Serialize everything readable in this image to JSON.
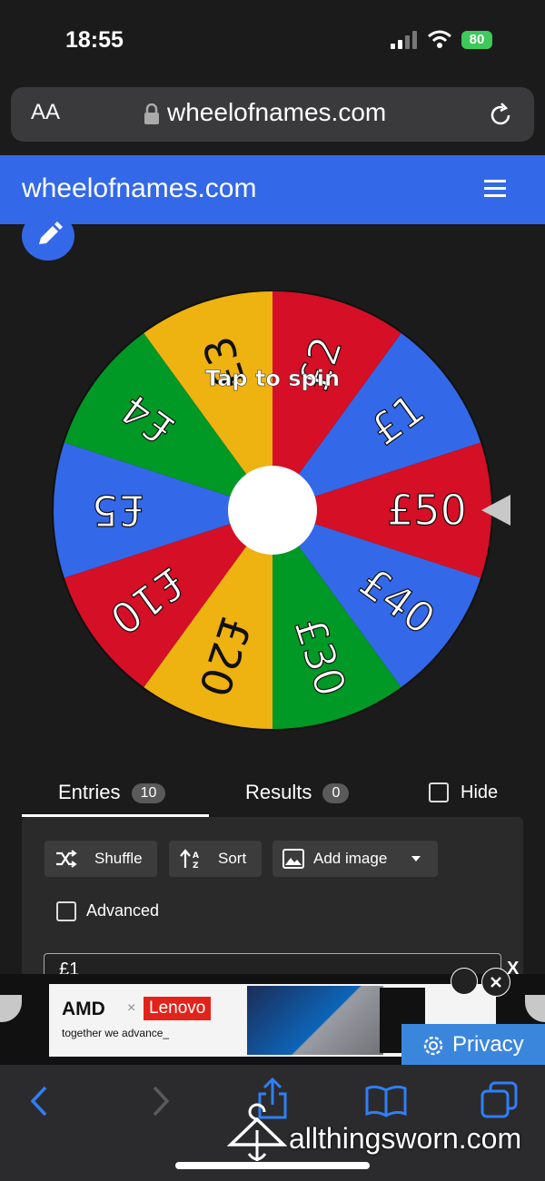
{
  "status": {
    "time": "18:55",
    "battery": "80"
  },
  "browser": {
    "text_size_label": "AA",
    "url": "wheelofnames.com"
  },
  "header": {
    "title": "wheelofnames.com"
  },
  "wheel": {
    "center_hint": "Tap to spin",
    "segments": [
      {
        "label": "£1",
        "color": "#3369e8"
      },
      {
        "label": "£50",
        "color": "#d50f25"
      },
      {
        "label": "£40",
        "color": "#3369e8"
      },
      {
        "label": "£30",
        "color": "#009925"
      },
      {
        "label": "£20",
        "color": "#eeb211"
      },
      {
        "label": "£10",
        "color": "#d50f25"
      },
      {
        "label": "£5",
        "color": "#3369e8"
      },
      {
        "label": "£4",
        "color": "#009925"
      },
      {
        "label": "£3",
        "color": "#eeb211"
      },
      {
        "label": "£2",
        "color": "#d50f25"
      }
    ]
  },
  "tabs": {
    "entries_label": "Entries",
    "entries_count": "10",
    "results_label": "Results",
    "results_count": "0",
    "hide_label": "Hide"
  },
  "toolbar": {
    "shuffle_label": "Shuffle",
    "sort_label": "Sort",
    "add_image_label": "Add image",
    "advanced_label": "Advanced"
  },
  "entries_text": "£1",
  "ad": {
    "brand1": "AMD",
    "brand2": "Lenovo",
    "tagline": "together we advance_",
    "close_label": "X",
    "privacy_label": "Privacy"
  },
  "watermark": "allthingsworn.com"
}
